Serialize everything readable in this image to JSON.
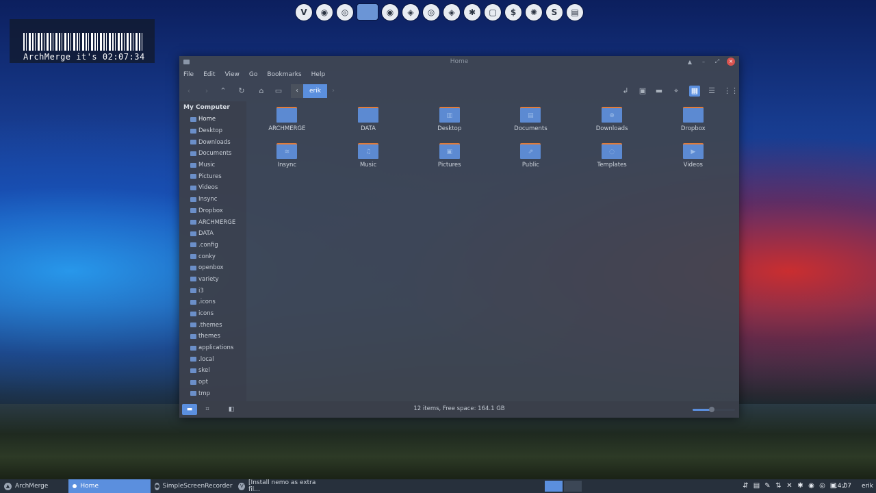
{
  "dock": {
    "icons": [
      "vivaldi-icon",
      "sync-icon",
      "chrome-icon",
      "folder-icon",
      "settings-icon",
      "bird-icon",
      "spiral-icon",
      "shell-icon",
      "gear-icon",
      "window-icon",
      "money-icon",
      "spin-icon",
      "skype-icon",
      "package-icon"
    ],
    "glyphs": [
      "V",
      "◉",
      "◎",
      "",
      "◉",
      "◈",
      "◎",
      "◈",
      "✱",
      "▢",
      "$",
      "✺",
      "S",
      "▤"
    ]
  },
  "conky": {
    "text": "ArchMerge it's 02:07:34"
  },
  "window": {
    "title": "Home",
    "controls": {
      "up": "▲",
      "minimize": "–",
      "maximize": "⤢",
      "close": "×"
    }
  },
  "menu": [
    "File",
    "Edit",
    "View",
    "Go",
    "Bookmarks",
    "Help"
  ],
  "toolbar": {
    "back": "‹",
    "forward": "›",
    "up": "⌃",
    "reload": "↻",
    "home": "⌂",
    "computer": "▭",
    "crumb_left": "‹",
    "crumb_current": "erik",
    "crumb_right": "›",
    "right_buttons": [
      "↲",
      "▣",
      "▬",
      "⌖",
      "▦",
      "☰",
      "⋮⋮"
    ]
  },
  "sidebar": {
    "header": "My Computer",
    "items": [
      "Home",
      "Desktop",
      "Downloads",
      "Documents",
      "Music",
      "Pictures",
      "Videos",
      "Insync",
      "Dropbox",
      "ARCHMERGE",
      "DATA",
      ".config",
      "conky",
      "openbox",
      "variety",
      "i3",
      ".icons",
      "icons",
      ".themes",
      "themes",
      "applications",
      ".local",
      "skel",
      "opt",
      "tmp"
    ]
  },
  "files": [
    {
      "name": "ARCHMERGE",
      "glyph": ""
    },
    {
      "name": "DATA",
      "glyph": ""
    },
    {
      "name": "Desktop",
      "glyph": "▥"
    },
    {
      "name": "Documents",
      "glyph": "▤"
    },
    {
      "name": "Downloads",
      "glyph": "⊕"
    },
    {
      "name": "Dropbox",
      "glyph": ""
    },
    {
      "name": "Insync",
      "glyph": "≋"
    },
    {
      "name": "Music",
      "glyph": "♫"
    },
    {
      "name": "Pictures",
      "glyph": "▣"
    },
    {
      "name": "Public",
      "glyph": "⇗"
    },
    {
      "name": "Templates",
      "glyph": "◌"
    },
    {
      "name": "Videos",
      "glyph": "▶"
    }
  ],
  "statusbar": {
    "text": "12 items, Free space: 164.1 GB",
    "btn_places": "▬",
    "btn_tree": "⌗",
    "btn_hide": "◧",
    "zoom_fraction": 0.45
  },
  "taskbar": {
    "menu_label": "ArchMerge",
    "tasks": [
      {
        "label": "Home",
        "active": true,
        "glyph": ""
      },
      {
        "label": "SimpleScreenRecorder",
        "active": false,
        "glyph": "●"
      },
      {
        "label": "[Install nemo as extra fil...",
        "active": false,
        "glyph": "V"
      }
    ],
    "tray": [
      "⇵",
      "▤",
      "✎",
      "⇅",
      "✕",
      "✱",
      "◉",
      "◎",
      "▣",
      "♪"
    ],
    "clock": "14:07",
    "user": "erik"
  },
  "colors": {
    "accent": "#5b8fde",
    "folder": "#5c8ad2",
    "folder_tab": "#e07b3a",
    "close": "#d9534f"
  }
}
